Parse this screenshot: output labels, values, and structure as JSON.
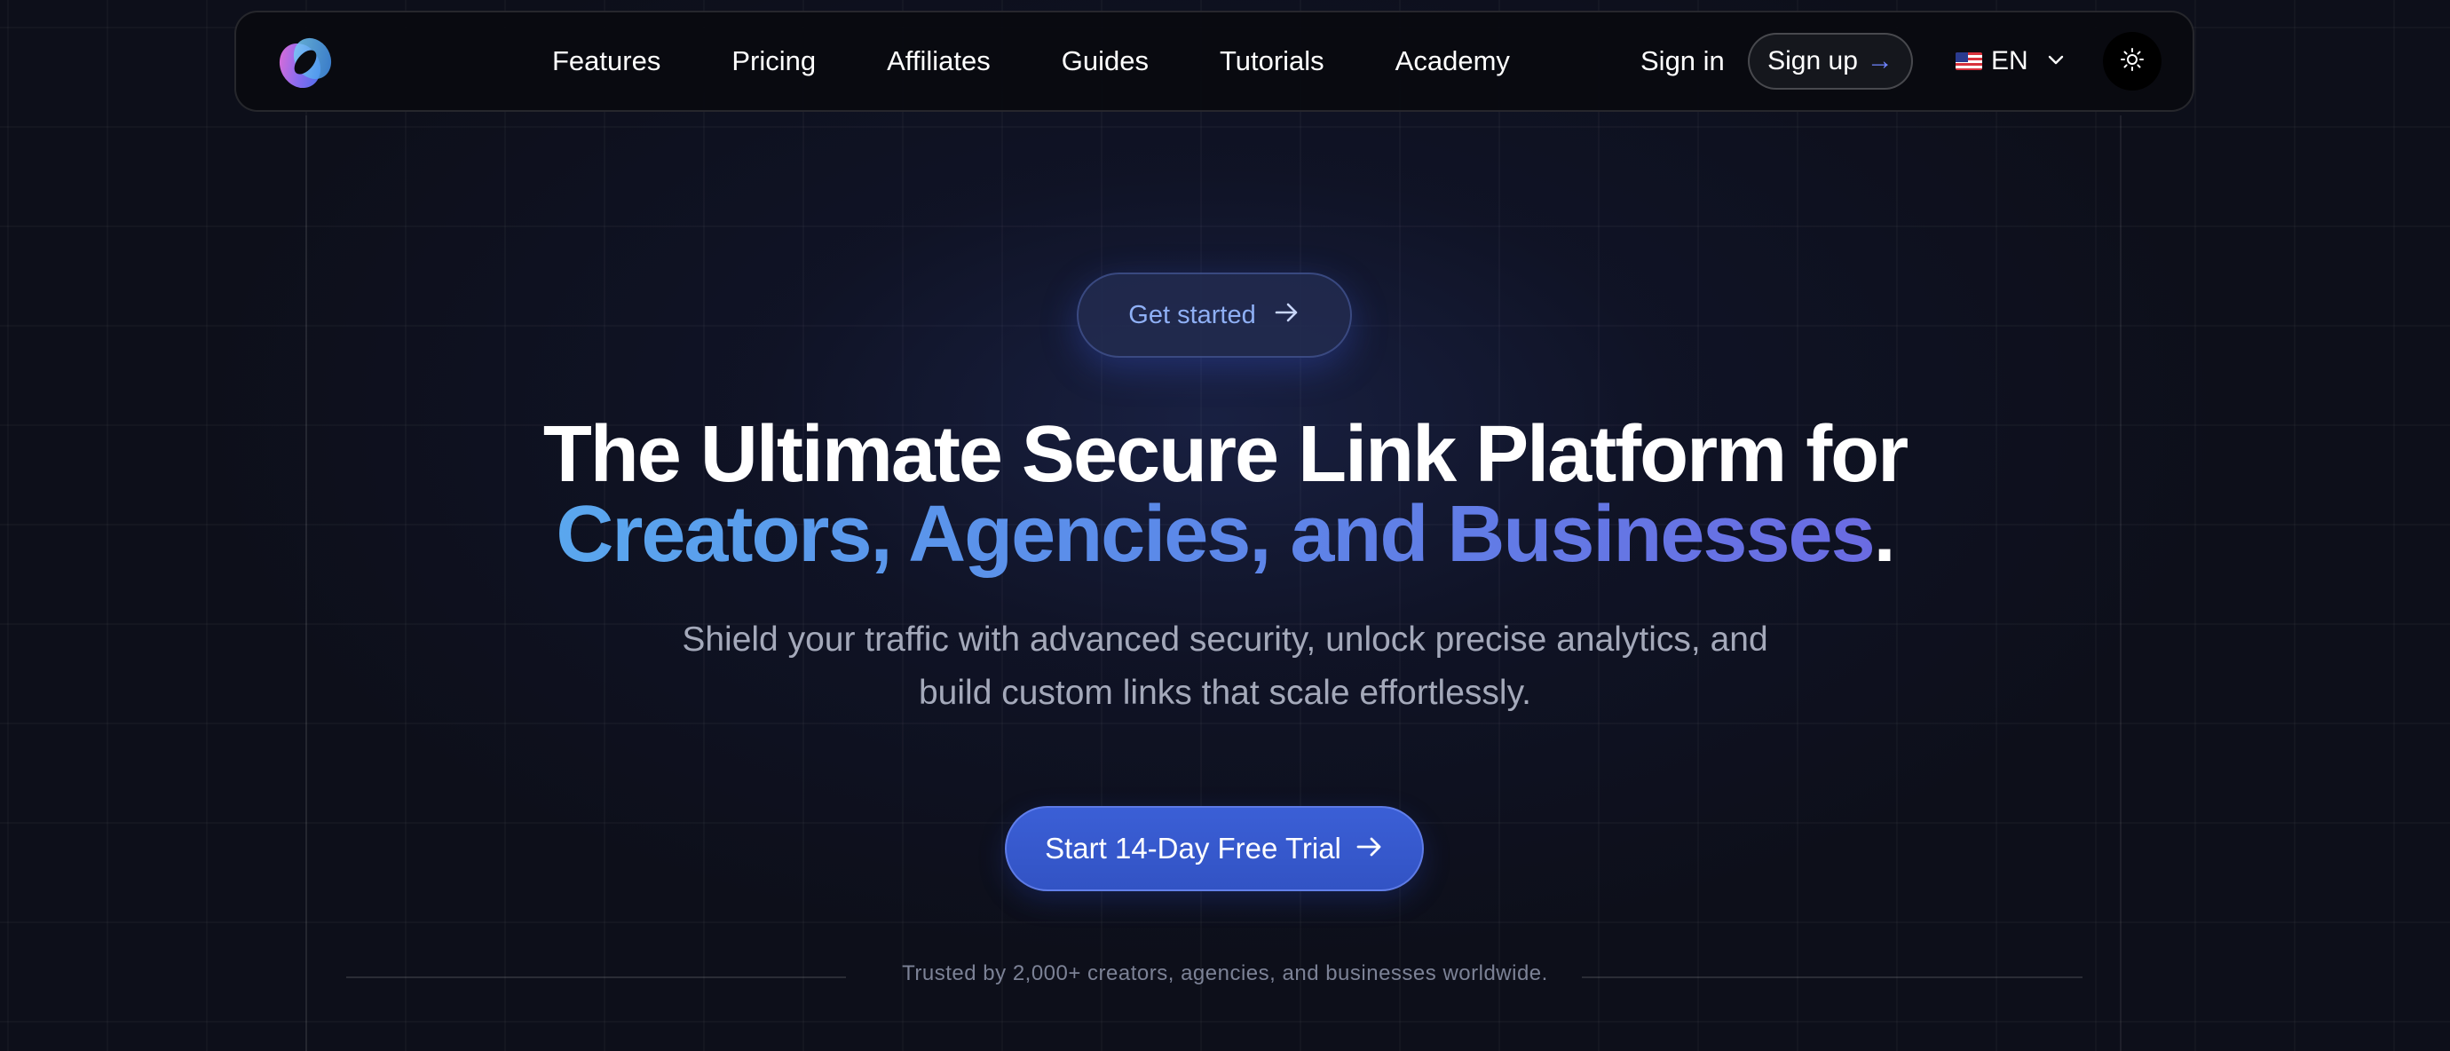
{
  "nav": {
    "links": [
      {
        "label": "Features"
      },
      {
        "label": "Pricing"
      },
      {
        "label": "Affiliates"
      },
      {
        "label": "Guides"
      },
      {
        "label": "Tutorials"
      },
      {
        "label": "Academy"
      }
    ],
    "sign_in": "Sign in",
    "sign_up": "Sign up",
    "sign_up_icon": "arrow-right-icon",
    "language": {
      "flag": "us-flag-icon",
      "code": "EN",
      "icon": "chevron-down-icon"
    },
    "theme_icon": "sun-icon",
    "logo": "brand-logo"
  },
  "hero": {
    "badge_label": "Get started",
    "badge_icon": "arrow-right-icon",
    "title_line1": "The Ultimate Secure Link Platform for",
    "title_line2_highlight": "Creators, Agencies, and Businesses",
    "title_line2_end": ".",
    "subtitle_line1": "Shield your traffic with advanced security, unlock precise analytics, and",
    "subtitle_line2": "build custom links that scale effortlessly.",
    "cta_label": "Start 14-Day Free Trial",
    "cta_icon": "arrow-right-icon",
    "trust_text": "Trusted by 2,000+ creators, agencies, and businesses worldwide."
  },
  "colors": {
    "background": "#0d0f1a",
    "accent": "#3b5fd6",
    "gradient_start": "#5aa7ee",
    "gradient_end": "#6a6be2",
    "badge_text": "#8fb0f5"
  }
}
